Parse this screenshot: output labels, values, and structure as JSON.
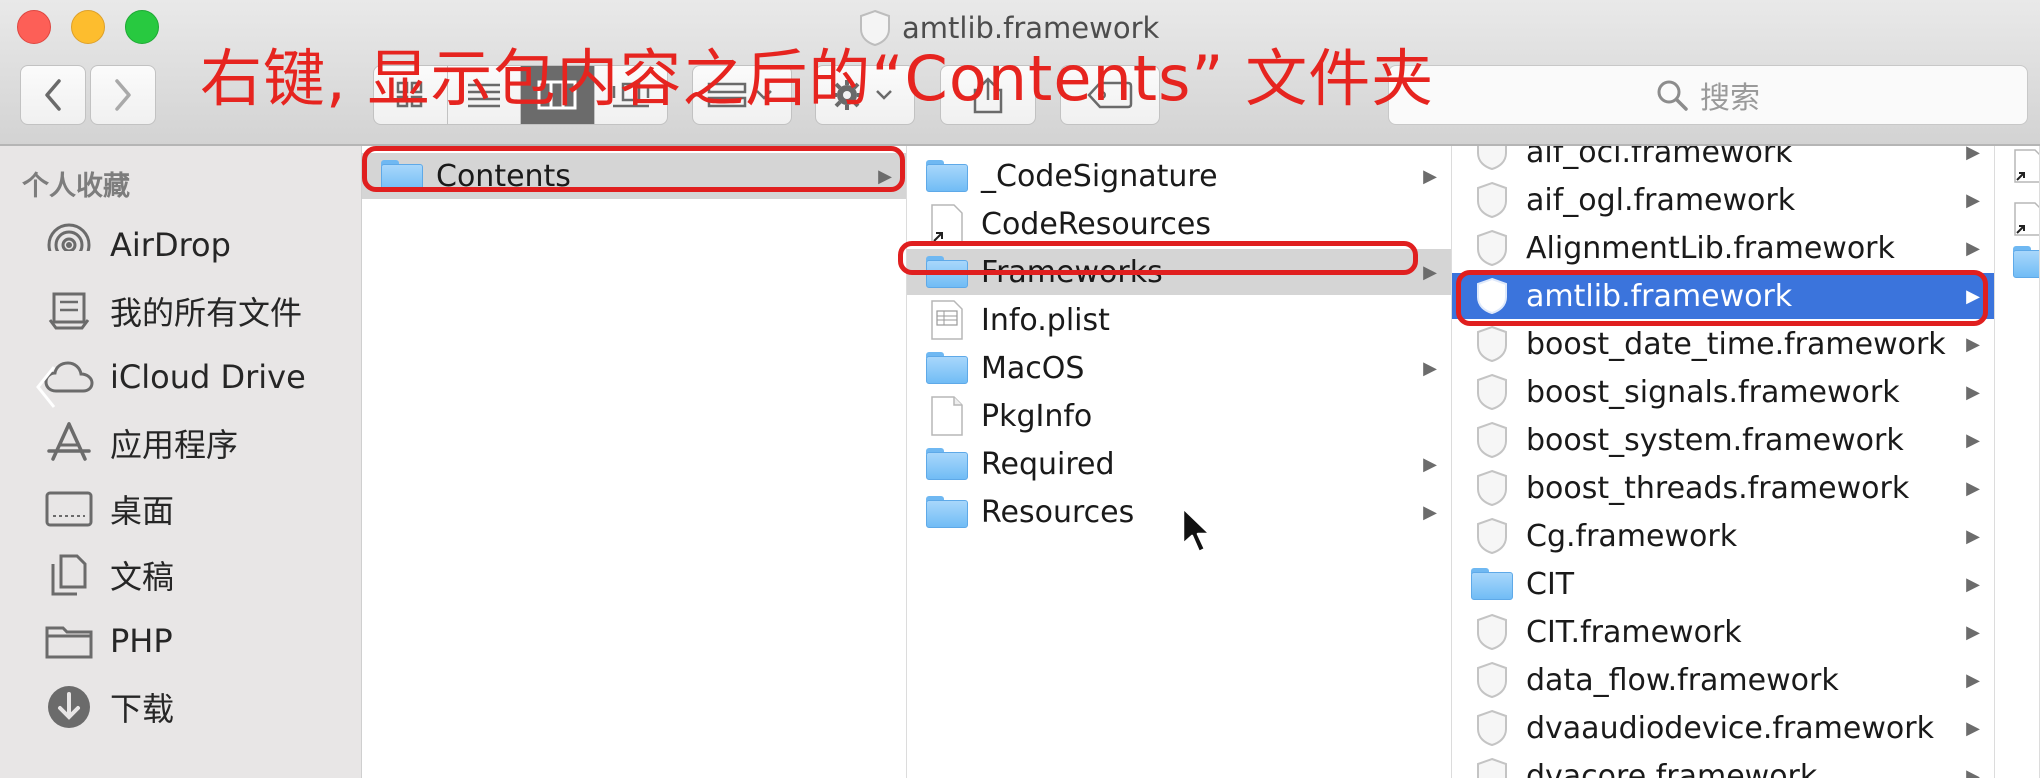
{
  "window": {
    "title": "amtlib.framework"
  },
  "annotation": {
    "text": "右键, 显示包内容之后的“Contents” 文件夹"
  },
  "toolbar": {
    "search_placeholder": "搜索"
  },
  "sidebar": {
    "heading": "个人收藏",
    "items": [
      {
        "label": "AirDrop",
        "icon": "airdrop-icon"
      },
      {
        "label": "我的所有文件",
        "icon": "all-files-icon"
      },
      {
        "label": "iCloud Drive",
        "icon": "cloud-icon"
      },
      {
        "label": "应用程序",
        "icon": "applications-icon"
      },
      {
        "label": "桌面",
        "icon": "desktop-icon"
      },
      {
        "label": "文稿",
        "icon": "documents-icon"
      },
      {
        "label": "PHP",
        "icon": "folder-icon"
      },
      {
        "label": "下载",
        "icon": "download-icon"
      }
    ]
  },
  "columns": {
    "col1": [
      {
        "name": "Contents",
        "kind": "folder",
        "expandable": true
      }
    ],
    "col2": [
      {
        "name": "_CodeSignature",
        "kind": "folder",
        "expandable": true
      },
      {
        "name": "CodeResources",
        "kind": "alias",
        "expandable": false
      },
      {
        "name": "Frameworks",
        "kind": "folder",
        "expandable": true
      },
      {
        "name": "Info.plist",
        "kind": "plist",
        "expandable": false
      },
      {
        "name": "MacOS",
        "kind": "folder",
        "expandable": true
      },
      {
        "name": "PkgInfo",
        "kind": "file",
        "expandable": false
      },
      {
        "name": "Required",
        "kind": "folder",
        "expandable": true
      },
      {
        "name": "Resources",
        "kind": "folder",
        "expandable": true
      }
    ],
    "col3": [
      {
        "name": "aif_ocl.framework",
        "kind": "framework"
      },
      {
        "name": "aif_ogl.framework",
        "kind": "framework"
      },
      {
        "name": "AlignmentLib.framework",
        "kind": "framework"
      },
      {
        "name": "amtlib.framework",
        "kind": "framework"
      },
      {
        "name": "boost_date_time.framework",
        "kind": "framework"
      },
      {
        "name": "boost_signals.framework",
        "kind": "framework"
      },
      {
        "name": "boost_system.framework",
        "kind": "framework"
      },
      {
        "name": "boost_threads.framework",
        "kind": "framework"
      },
      {
        "name": "Cg.framework",
        "kind": "framework"
      },
      {
        "name": "CIT",
        "kind": "folder"
      },
      {
        "name": "CIT.framework",
        "kind": "framework"
      },
      {
        "name": "data_flow.framework",
        "kind": "framework"
      },
      {
        "name": "dvaaudiodevice.framework",
        "kind": "framework"
      },
      {
        "name": "dvacore.framework",
        "kind": "framework"
      }
    ]
  },
  "colors": {
    "selection_blue": "#3b74dc",
    "annotation_red": "#e6241f"
  }
}
